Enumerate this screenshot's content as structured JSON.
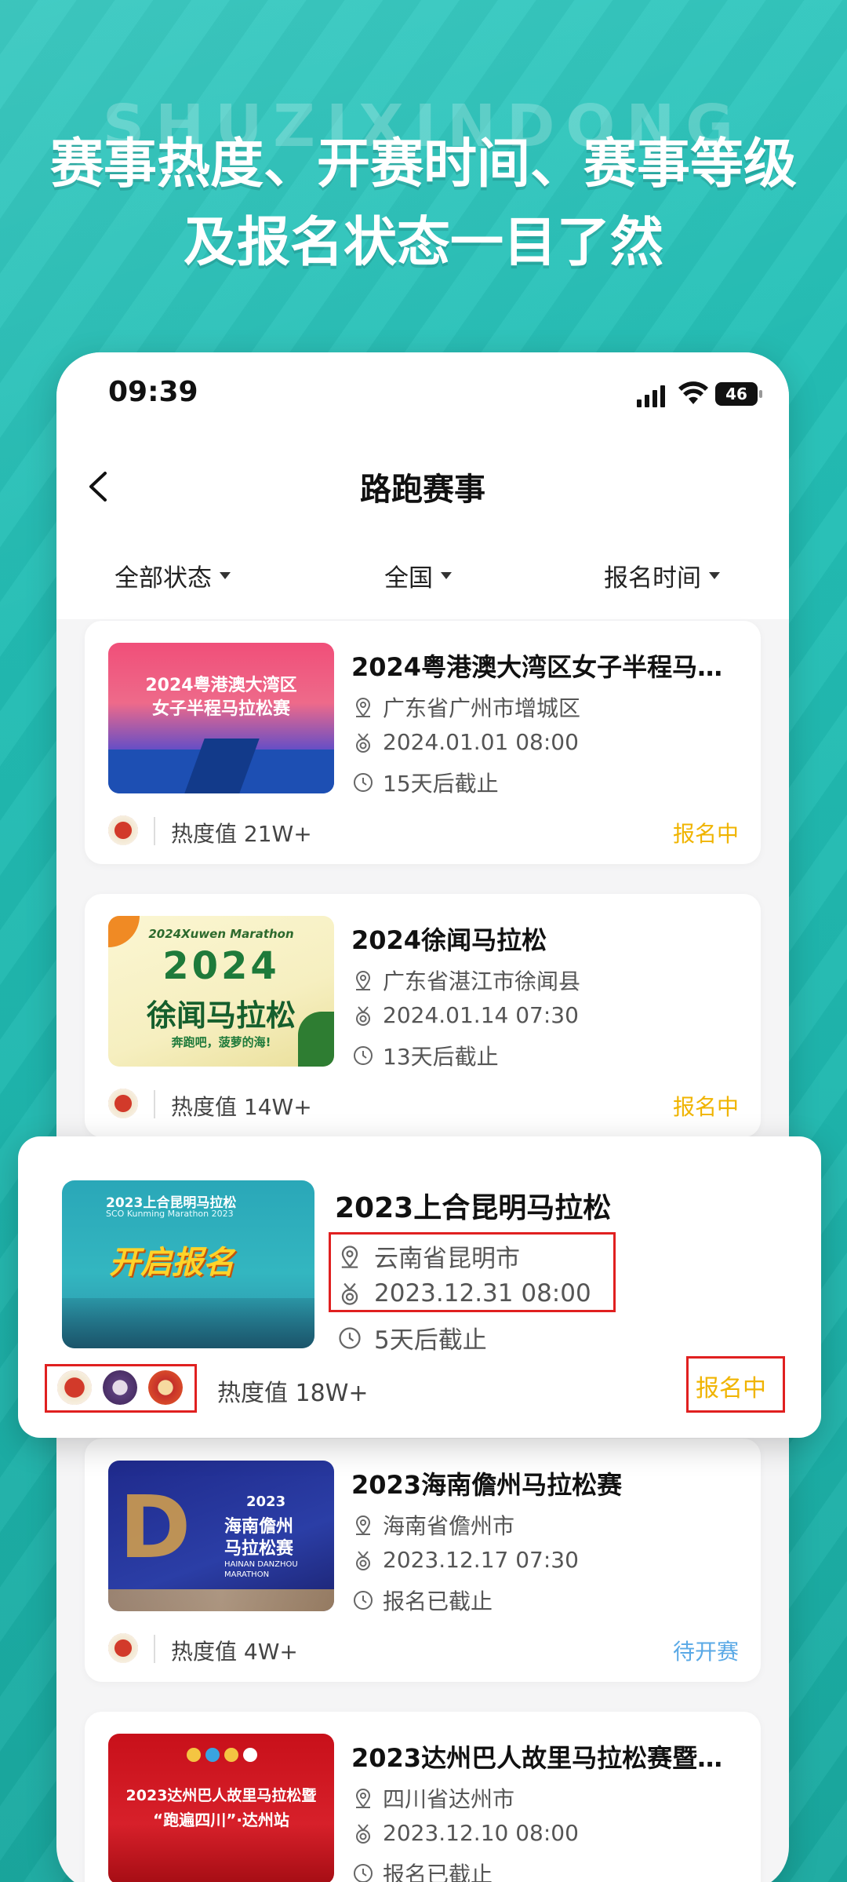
{
  "promo": {
    "watermark": "SHUZIXINDONG",
    "headline_line1": "赛事热度、开赛时间、赛事等级",
    "headline_line2": "及报名状态一目了然"
  },
  "status_bar": {
    "time": "09:39",
    "battery": "46"
  },
  "nav": {
    "title": "路跑赛事"
  },
  "filters": [
    {
      "label": "全部状态"
    },
    {
      "label": "全国"
    },
    {
      "label": "报名时间"
    }
  ],
  "events": [
    {
      "name": "2024粤港澳大湾区女子半程马拉松赛",
      "location": "广东省广州市增城区",
      "start_time": "2024.01.01 08:00",
      "deadline": "15天后截止",
      "heat": "热度值 21W+",
      "status": "报名中",
      "poster_line1": "2024粤港澳大湾区",
      "poster_line2": "女子半程马拉松赛"
    },
    {
      "name": "2024徐闻马拉松",
      "location": "广东省湛江市徐闻县",
      "start_time": "2024.01.14 07:30",
      "deadline": "13天后截止",
      "heat": "热度值 14W+",
      "status": "报名中",
      "poster_line1": "2024Xuwen Marathon",
      "poster_line2": "2024",
      "poster_line3": "徐闻马拉松",
      "poster_line4": "奔跑吧，菠萝的海!"
    },
    {
      "name": "2023上合昆明马拉松",
      "location": "云南省昆明市",
      "start_time": "2023.12.31 08:00",
      "deadline": "5天后截止",
      "heat": "热度值 18W+",
      "status": "报名中",
      "poster_line1": "2023上合昆明马拉松",
      "poster_line2": "SCO Kunming Marathon 2023",
      "poster_line3": "开启报名"
    },
    {
      "name": "2023海南儋州马拉松赛",
      "location": "海南省儋州市",
      "start_time": "2023.12.17 07:30",
      "deadline": "报名已截止",
      "heat": "热度值 4W+",
      "status": "待开赛",
      "poster_line1": "2023",
      "poster_line2": "海南儋州",
      "poster_line3": "马拉松赛",
      "poster_line4": "HAINAN DANZHOU MARATHON"
    },
    {
      "name": "2023达州巴人故里马拉松赛暨“跑遍四川”·达州站",
      "location": "四川省达州市",
      "start_time": "2023.12.10 08:00",
      "deadline": "报名已截止",
      "poster_line1": "2023达州巴人故里马拉松暨",
      "poster_line2": "“跑遍四川”·达州站"
    }
  ],
  "colors": {
    "background": "#22bdb4",
    "status_open": "#f0b400",
    "status_pending": "#5aa9e6",
    "highlight_box": "#e02020"
  }
}
